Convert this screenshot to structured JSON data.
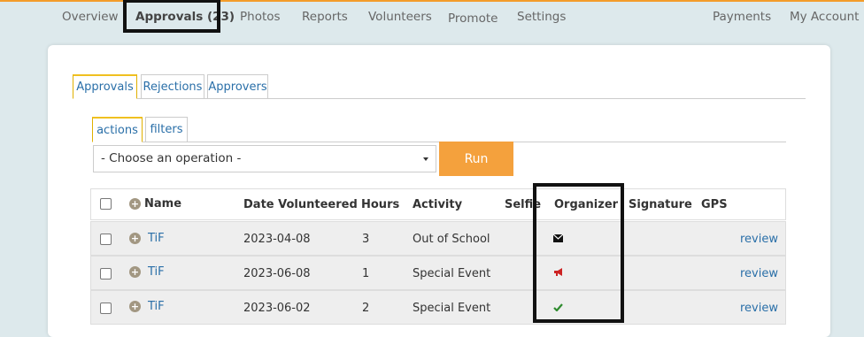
{
  "topnav": {
    "left": [
      "Overview",
      "Approvals (23)",
      "Photos",
      "Reports",
      "Volunteers",
      "Promote",
      "Settings"
    ],
    "right": [
      "Payments",
      "My Account"
    ],
    "active": "Approvals (23)"
  },
  "tabs": [
    "Approvals",
    "Rejections",
    "Approvers"
  ],
  "subtabs": [
    "actions",
    "filters"
  ],
  "operation": {
    "selected": "- Choose an operation -",
    "run_label": "Run"
  },
  "table": {
    "headers": {
      "name": "Name",
      "date": "Date Volunteered",
      "hours": "Hours",
      "activity": "Activity",
      "selfie": "Selfie",
      "organizer": "Organizer",
      "signature": "Signature",
      "gps": "GPS"
    },
    "rows": [
      {
        "name": "TiF",
        "date": "2023-04-08",
        "hours": "3",
        "activity": "Out of School",
        "organizer_icon": "envelope-icon",
        "action": "review"
      },
      {
        "name": "TiF",
        "date": "2023-06-08",
        "hours": "1",
        "activity": "Special Event",
        "organizer_icon": "megaphone-icon",
        "action": "review"
      },
      {
        "name": "TiF",
        "date": "2023-06-02",
        "hours": "2",
        "activity": "Special Event",
        "organizer_icon": "checkmark-icon",
        "action": "review"
      }
    ]
  },
  "colors": {
    "accent": "#f4a13d",
    "link": "#2a6fa8",
    "page_bg": "#dde9ec",
    "check": "#2e8b2e",
    "megaphone": "#cc2222"
  }
}
